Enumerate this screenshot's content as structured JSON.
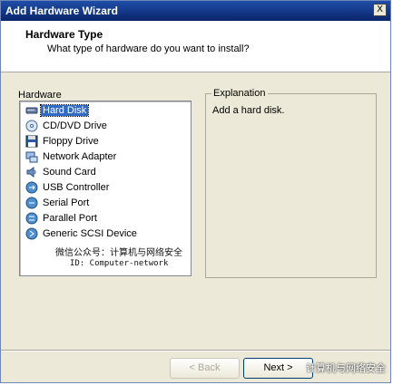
{
  "window": {
    "title": "Add Hardware Wizard",
    "close_label": "X"
  },
  "header": {
    "title": "Hardware Type",
    "subtitle": "What type of hardware do you want to install?"
  },
  "hardware": {
    "label": "Hardware",
    "items": [
      {
        "label": "Hard Disk",
        "icon": "hard-disk-icon",
        "selected": true
      },
      {
        "label": "CD/DVD Drive",
        "icon": "cd-dvd-icon"
      },
      {
        "label": "Floppy Drive",
        "icon": "floppy-icon"
      },
      {
        "label": "Network Adapter",
        "icon": "network-adapter-icon"
      },
      {
        "label": "Sound Card",
        "icon": "sound-card-icon"
      },
      {
        "label": "USB Controller",
        "icon": "usb-controller-icon"
      },
      {
        "label": "Serial Port",
        "icon": "serial-port-icon"
      },
      {
        "label": "Parallel Port",
        "icon": "parallel-port-icon"
      },
      {
        "label": "Generic SCSI Device",
        "icon": "scsi-device-icon"
      }
    ],
    "watermark_line1": "微信公众号：计算机与网络安全",
    "watermark_line2": "ID: Computer-network"
  },
  "explanation": {
    "label": "Explanation",
    "text": "Add a hard disk."
  },
  "buttons": {
    "back": "< Back",
    "next": "Next >"
  },
  "overlay_watermark": "计算机与网络安全",
  "colors": {
    "selection": "#316ac5",
    "titlebar": "#0a246a",
    "dialog_bg": "#ece9d8"
  }
}
